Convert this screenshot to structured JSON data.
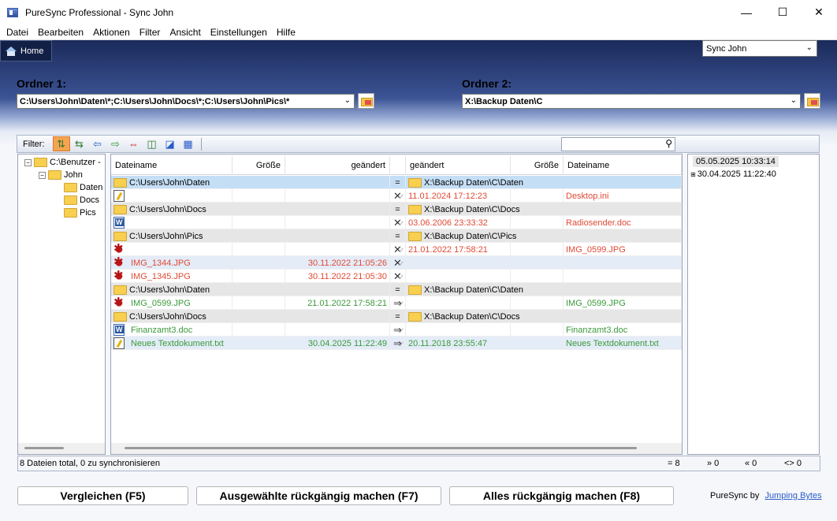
{
  "window": {
    "title": "PureSync Professional  -  Sync John"
  },
  "menu": [
    "Datei",
    "Bearbeiten",
    "Aktionen",
    "Filter",
    "Ansicht",
    "Einstellungen",
    "Hilfe"
  ],
  "home_tab": "Home",
  "profile": {
    "selected": "Sync John"
  },
  "folder1": {
    "label": "Ordner 1:",
    "path": "C:\\Users\\John\\Daten\\*;C:\\Users\\John\\Docs\\*;C:\\Users\\John\\Pics\\*"
  },
  "folder2": {
    "label": "Ordner 2:",
    "path": "X:\\Backup Daten\\C"
  },
  "toolbar": {
    "filter_label": "Filter:"
  },
  "tree": [
    {
      "label": "C:\\Benutzer -",
      "level": 0
    },
    {
      "label": "John",
      "level": 1
    },
    {
      "label": "Daten",
      "level": 2
    },
    {
      "label": "Docs",
      "level": 2
    },
    {
      "label": "Pics",
      "level": 2
    }
  ],
  "grid": {
    "headers": [
      "Dateiname",
      "Größe",
      "geändert",
      "",
      "geändert",
      "Größe",
      "Dateiname"
    ],
    "rows": [
      {
        "type": "folder",
        "left": "C:\\Users\\John\\Daten",
        "mid": "=",
        "right": "X:\\Backup Daten\\C\\Daten",
        "state": "sel"
      },
      {
        "type": "file",
        "icon": "txt",
        "lname": "",
        "lsize": "",
        "ldate": "",
        "act": "x",
        "rdate": "11.01.2024 17:12:23",
        "rsize": "",
        "rname": "Desktop.ini",
        "color": "red"
      },
      {
        "type": "folder",
        "left": "C:\\Users\\John\\Docs",
        "mid": "=",
        "right": "X:\\Backup Daten\\C\\Docs"
      },
      {
        "type": "file",
        "icon": "doc",
        "lname": "",
        "lsize": "",
        "ldate": "",
        "act": "x",
        "rdate": "03.06.2006 23:33:32",
        "rsize": "",
        "rname": "Radiosender.doc",
        "color": "red"
      },
      {
        "type": "folder",
        "left": "C:\\Users\\John\\Pics",
        "mid": "=",
        "right": "X:\\Backup Daten\\C\\Pics"
      },
      {
        "type": "file",
        "icon": "img",
        "lname": "",
        "lsize": "",
        "ldate": "",
        "act": "x",
        "rdate": "21.01.2022 17:58:21",
        "rsize": "",
        "rname": "IMG_0599.JPG",
        "color": "red"
      },
      {
        "type": "file",
        "icon": "img",
        "lname": "IMG_1344.JPG",
        "lsize": "",
        "ldate": "30.11.2022 21:05:26",
        "act": "x",
        "rdate": "",
        "rsize": "",
        "rname": "",
        "color": "red",
        "state": "hl"
      },
      {
        "type": "file",
        "icon": "img",
        "lname": "IMG_1345.JPG",
        "lsize": "",
        "ldate": "30.11.2022 21:05:30",
        "act": "x",
        "rdate": "",
        "rsize": "",
        "rname": "",
        "color": "red"
      },
      {
        "type": "folder",
        "left": "C:\\Users\\John\\Daten",
        "mid": "=",
        "right": "X:\\Backup Daten\\C\\Daten"
      },
      {
        "type": "file",
        "icon": "img",
        "lname": "IMG_0599.JPG",
        "lsize": "",
        "ldate": "21.01.2022 17:58:21",
        "act": "arrow",
        "rdate": "",
        "rsize": "",
        "rname": "IMG_0599.JPG",
        "color": "green"
      },
      {
        "type": "folder",
        "left": "C:\\Users\\John\\Docs",
        "mid": "=",
        "right": "X:\\Backup Daten\\C\\Docs"
      },
      {
        "type": "file",
        "icon": "doc",
        "lname": "Finanzamt3.doc",
        "lsize": "",
        "ldate": "",
        "act": "arrow",
        "rdate": "",
        "rsize": "",
        "rname": "Finanzamt3.doc",
        "color": "green"
      },
      {
        "type": "file",
        "icon": "txt",
        "lname": "Neues Textdokument.txt",
        "lsize": "",
        "ldate": "30.04.2025 11:22:49",
        "act": "arrow",
        "rdate": "20.11.2018 23:55:47",
        "rsize": "",
        "rname": "Neues Textdokument.txt",
        "color": "green",
        "state": "hl"
      }
    ]
  },
  "timestamps": [
    "05.05.2025 10:33:14",
    "30.04.2025 11:22:40"
  ],
  "status": {
    "summary": "8 Dateien total,  0 zu synchronisieren",
    "eq": "= 8",
    "right": "» 0",
    "left": "« 0",
    "diff": "<> 0"
  },
  "buttons": {
    "compare": "Vergleichen (F5)",
    "undo_selected": "Ausgewählte rückgängig machen (F7)",
    "undo_all": "Alles rückgängig machen  (F8)"
  },
  "credit": {
    "text": "PureSync by",
    "link": "Jumping Bytes"
  }
}
